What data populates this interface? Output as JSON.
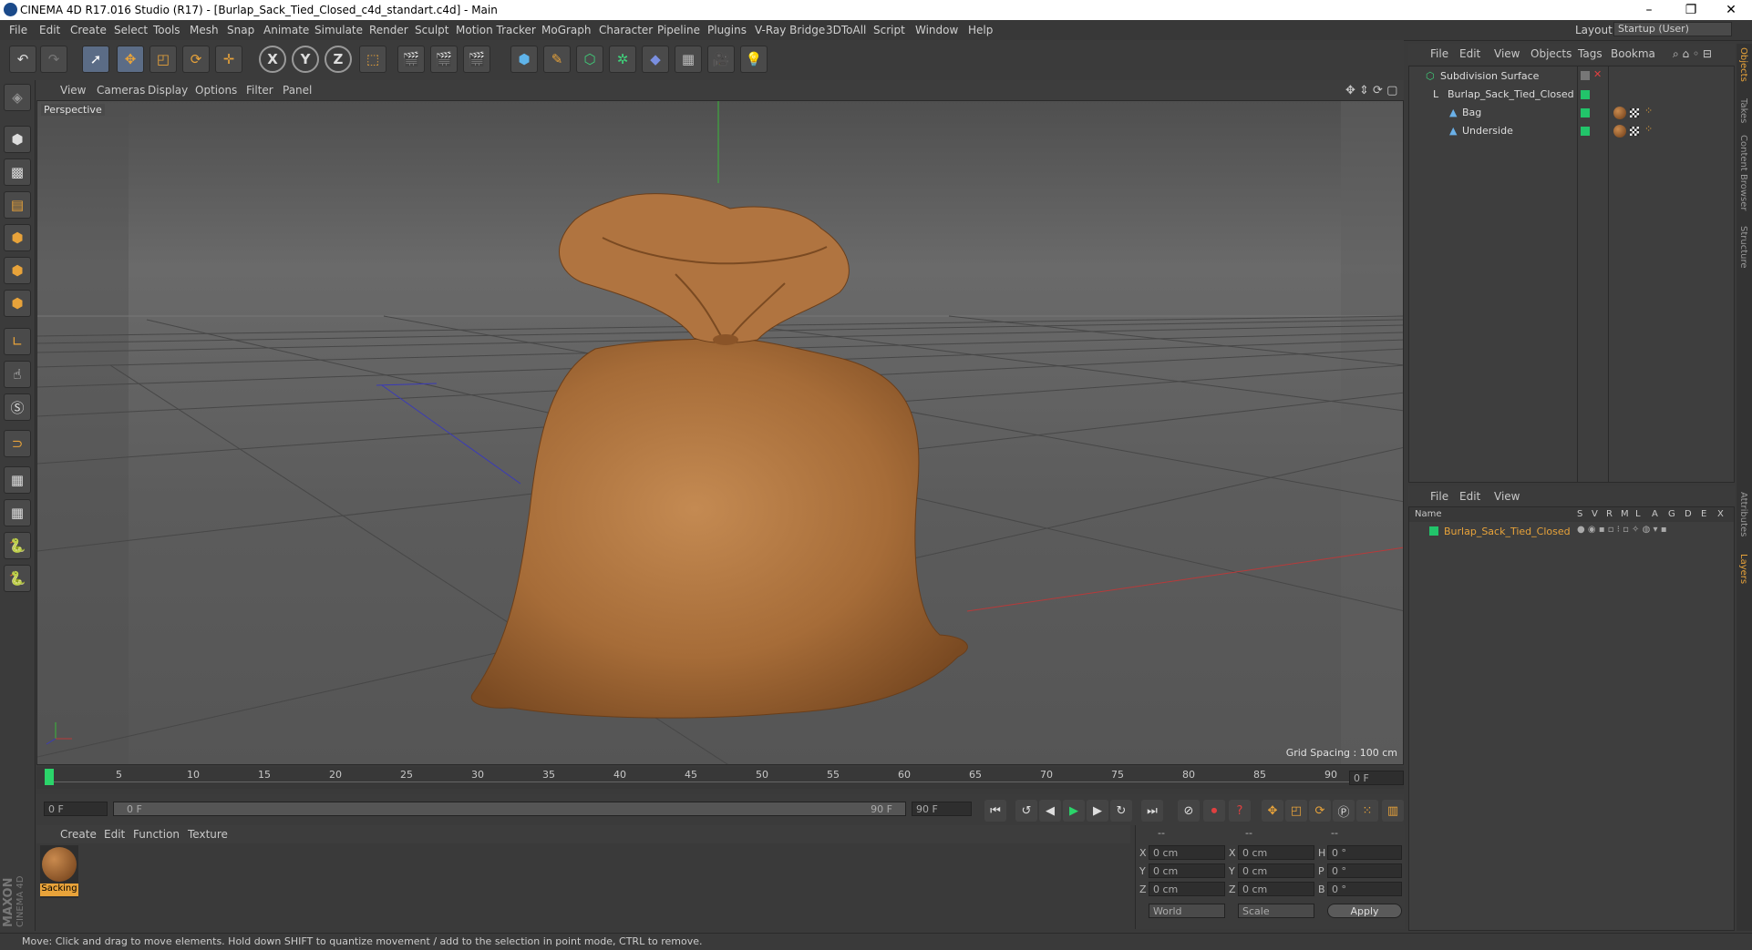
{
  "window": {
    "title": "CINEMA 4D R17.016 Studio (R17) - [Burlap_Sack_Tied_Closed_c4d_standart.c4d] - Main",
    "min": "–",
    "max": "❐",
    "close": "✕"
  },
  "menu": [
    "File",
    "Edit",
    "Create",
    "Select",
    "Tools",
    "Mesh",
    "Snap",
    "Animate",
    "Simulate",
    "Render",
    "Sculpt",
    "Motion Tracker",
    "MoGraph",
    "Character",
    "Pipeline",
    "Plugins",
    "V-Ray Bridge",
    "3DToAll",
    "Script",
    "Window",
    "Help"
  ],
  "layout": {
    "label": "Layout:",
    "value": "Startup (User)"
  },
  "toolbar": {
    "axis_x": "X",
    "axis_y": "Y",
    "axis_z": "Z"
  },
  "viewport": {
    "menu": [
      "View",
      "Cameras",
      "Display",
      "Options",
      "Filter",
      "Panel"
    ],
    "camera_label": "Perspective",
    "grid_spacing": "Grid Spacing : 100 cm"
  },
  "timeline": {
    "ticks": [
      "0",
      "5",
      "10",
      "15",
      "20",
      "25",
      "30",
      "35",
      "40",
      "45",
      "50",
      "55",
      "60",
      "65",
      "70",
      "75",
      "80",
      "85",
      "90"
    ],
    "current_frame": "0 F",
    "start_field": "0 F",
    "range_start": "0 F",
    "range_end": "90 F",
    "end_field": "90 F"
  },
  "materials": {
    "menu": [
      "Create",
      "Edit",
      "Function",
      "Texture"
    ],
    "items": [
      {
        "name": "Sacking"
      }
    ]
  },
  "coords": {
    "header": [
      "--",
      "--",
      "--"
    ],
    "rows": [
      {
        "a": "X",
        "av": "0 cm",
        "b": "X",
        "bv": "0 cm",
        "c": "H",
        "cv": "0 °"
      },
      {
        "a": "Y",
        "av": "0 cm",
        "b": "Y",
        "bv": "0 cm",
        "c": "P",
        "cv": "0 °"
      },
      {
        "a": "Z",
        "av": "0 cm",
        "b": "Z",
        "bv": "0 cm",
        "c": "B",
        "cv": "0 °"
      }
    ],
    "mode1": "World",
    "mode2": "Scale",
    "apply": "Apply"
  },
  "objects": {
    "menu": [
      "File",
      "Edit",
      "View",
      "Objects",
      "Tags",
      "Bookma"
    ],
    "tree": [
      {
        "name": "Subdivision Surface"
      },
      {
        "name": "Burlap_Sack_Tied_Closed"
      },
      {
        "name": "Bag"
      },
      {
        "name": "Underside"
      }
    ]
  },
  "layers": {
    "menu": [
      "File",
      "Edit",
      "View"
    ],
    "columns": [
      "Name",
      "S",
      "V",
      "R",
      "M",
      "L",
      "A",
      "G",
      "D",
      "E",
      "X"
    ],
    "rows": [
      {
        "name": "Burlap_Sack_Tied_Closed"
      }
    ]
  },
  "side_tabs": [
    "Objects",
    "Takes",
    "Content Browser",
    "Structure",
    "Attributes",
    "Layers"
  ],
  "brand": {
    "line1": "MAXON",
    "line2": "CINEMA 4D"
  },
  "status": "Move: Click and drag to move elements. Hold down SHIFT to quantize movement / add to the selection in point mode, CTRL to remove."
}
